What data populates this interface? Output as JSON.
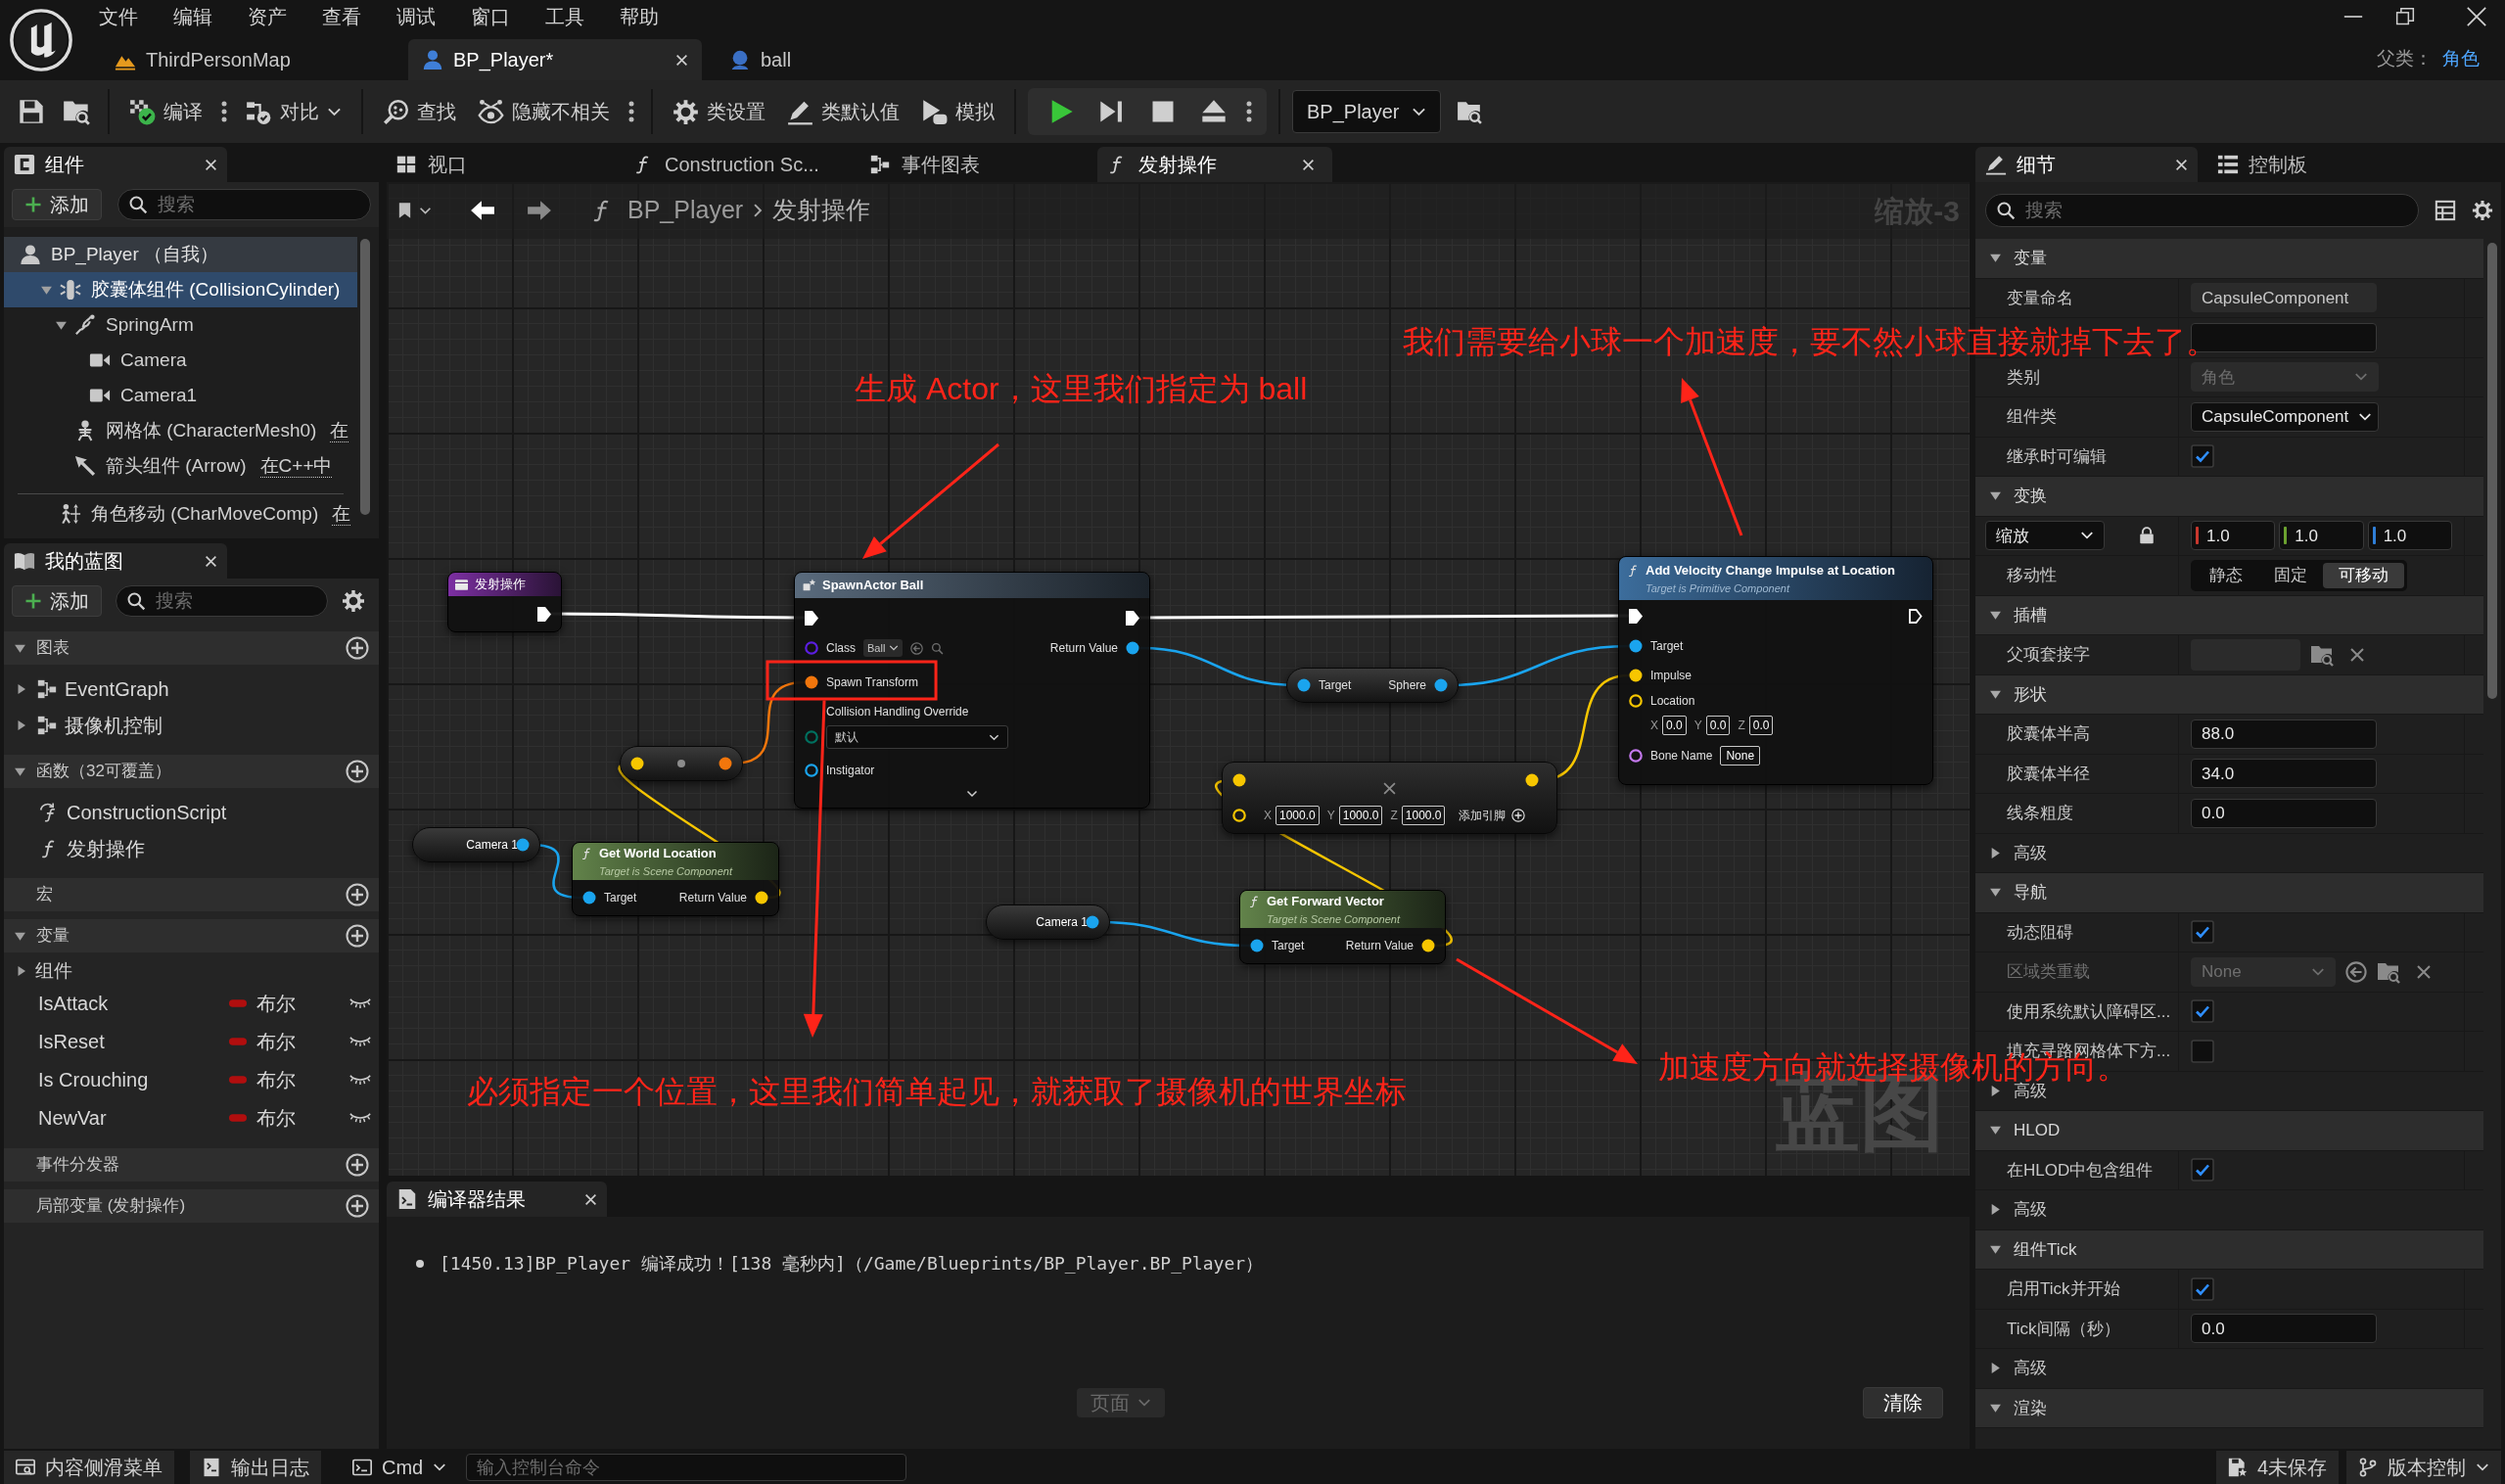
{
  "menu": [
    "文件",
    "编辑",
    "资产",
    "查看",
    "调试",
    "窗口",
    "工具",
    "帮助"
  ],
  "document_tabs": [
    {
      "label": "ThirdPersonMap",
      "kind": "level",
      "selected": false
    },
    {
      "label": "BP_Player*",
      "kind": "blueprint",
      "selected": true
    },
    {
      "label": "ball",
      "kind": "actor",
      "selected": false
    }
  ],
  "parent_class": {
    "label": "父类：",
    "value": "角色"
  },
  "toolbar": {
    "groups": [
      {
        "items": [
          {
            "kind": "save"
          },
          {
            "kind": "browse"
          }
        ]
      },
      {
        "items": [
          {
            "kind": "compile",
            "label": "编译",
            "menu": true
          },
          {
            "kind": "diff",
            "label": "对比",
            "dropdown": true
          }
        ]
      },
      {
        "items": [
          {
            "kind": "find",
            "label": "查找"
          },
          {
            "kind": "hide_unrelated",
            "label": "隐藏不相关",
            "menu": true
          }
        ]
      },
      {
        "items": [
          {
            "kind": "class_settings",
            "label": "类设置"
          },
          {
            "kind": "class_defaults",
            "label": "类默认值"
          },
          {
            "kind": "simulate",
            "label": "模拟"
          }
        ]
      },
      {
        "boxed": true,
        "items": [
          {
            "kind": "play"
          },
          {
            "kind": "advance"
          },
          {
            "kind": "stop"
          },
          {
            "kind": "eject"
          },
          {
            "kind": "more"
          }
        ]
      }
    ],
    "debug_object": "BP_Player"
  },
  "components_panel": {
    "tab": "组件",
    "add_button": "添加",
    "search_placeholder": "搜索",
    "tree": [
      {
        "label": "BP_Player （自我）",
        "kind": "self",
        "selected": false,
        "children": [
          {
            "label": "胶囊体组件 (CollisionCylinder)",
            "kind": "capsule",
            "selected": true,
            "expanded": true,
            "children": [
              {
                "label": "SpringArm",
                "kind": "spring_arm",
                "selected": false,
                "expanded": true,
                "children": [
                  {
                    "label": "Camera",
                    "kind": "camera",
                    "selected": false
                  },
                  {
                    "label": "Camera1",
                    "kind": "camera",
                    "selected": false
                  }
                ]
              },
              {
                "label": "网格体 (CharacterMesh0)",
                "kind": "mesh",
                "selected": false,
                "note": "在"
              },
              {
                "label": "箭头组件 (Arrow)",
                "kind": "arrow",
                "selected": false,
                "note": "在C++中"
              }
            ]
          }
        ]
      }
    ],
    "other_components": [
      {
        "label": "角色移动 (CharMoveComp)",
        "kind": "movement",
        "selected": false,
        "note": "在"
      }
    ]
  },
  "my_blueprint": {
    "tab": "我的蓝图",
    "add_button": "添加",
    "search_placeholder": "搜索",
    "sections": [
      {
        "title": "图表",
        "expanded": true,
        "items": [
          {
            "label": "EventGraph",
            "kind": "graph",
            "expanded": false
          },
          {
            "label": "摄像机控制",
            "kind": "graph",
            "expanded": false
          }
        ]
      },
      {
        "title": "函数（32可覆盖）",
        "expanded": true,
        "items": [
          {
            "label": "ConstructionScript",
            "kind": "construction"
          },
          {
            "label": "发射操作",
            "kind": "function"
          }
        ]
      },
      {
        "title": "宏"
      },
      {
        "title": "变量",
        "expanded": true,
        "categories": [
          {
            "label": "组件",
            "expanded": false
          }
        ],
        "variables": [
          {
            "name": "IsAttack",
            "type": "布尔",
            "exposed": false
          },
          {
            "name": "IsReset",
            "type": "布尔",
            "exposed": false
          },
          {
            "name": "Is Crouching",
            "type": "布尔",
            "exposed": false
          },
          {
            "name": "NewVar",
            "type": "布尔",
            "exposed": false
          }
        ]
      },
      {
        "title": "事件分发器"
      },
      {
        "title": "局部变量 (发射操作)"
      }
    ]
  },
  "graph_tabs": [
    {
      "label": "视口",
      "kind": "viewport",
      "selected": false
    },
    {
      "label": "Construction Sc...",
      "kind": "construction",
      "selected": false
    },
    {
      "label": "事件图表",
      "kind": "event_graph",
      "selected": false
    },
    {
      "label": "发射操作",
      "kind": "function",
      "selected": true
    }
  ],
  "graph": {
    "breadcrumb": [
      "BP_Player",
      "发射操作"
    ],
    "zoom_label": "缩放-3",
    "graph_type_label": "蓝图",
    "nodes": [
      {
        "kind": "entry",
        "title": "发射操作",
        "outputs": [
          {
            "kind": "exec",
            "connected": true
          }
        ]
      },
      {
        "kind": "spawn",
        "title": "SpawnActor Ball",
        "advanced_expanded": false,
        "inputs": [
          {
            "kind": "exec",
            "connected": true
          },
          {
            "label": "Class",
            "kind": "class",
            "connected": false,
            "value": "Ball"
          },
          {
            "label": "Spawn Transform",
            "kind": "transform",
            "connected": true
          },
          {
            "label": "Collision Handling Override",
            "kind": "enum",
            "connected": false,
            "value": "默认"
          },
          {
            "label": "Instigator",
            "kind": "object",
            "connected": false
          }
        ],
        "outputs": [
          {
            "kind": "exec",
            "connected": true
          },
          {
            "label": "Return Value",
            "kind": "object",
            "connected": true
          }
        ]
      },
      {
        "kind": "conversion",
        "inputs": [
          {
            "kind": "vector",
            "connected": true
          }
        ],
        "outputs": [
          {
            "kind": "transform",
            "connected": true
          }
        ]
      },
      {
        "kind": "variable",
        "title": "Camera 1",
        "outputs": [
          {
            "kind": "object",
            "connected": true
          }
        ]
      },
      {
        "kind": "pure",
        "title": "Get World Location",
        "subtitle": "Target is Scene Component",
        "inputs": [
          {
            "label": "Target",
            "kind": "object",
            "connected": true
          }
        ],
        "outputs": [
          {
            "label": "Return Value",
            "kind": "vector",
            "connected": true
          }
        ]
      },
      {
        "kind": "compact",
        "inputs": [
          {
            "label": "Target",
            "kind": "object",
            "connected": true
          }
        ],
        "outputs": [
          {
            "label": "Sphere",
            "kind": "object",
            "connected": true
          }
        ]
      },
      {
        "kind": "call",
        "title": "Add Velocity Change Impulse at Location",
        "subtitle": "Target is Primitive Component",
        "inputs": [
          {
            "kind": "exec",
            "connected": true
          },
          {
            "label": "Target",
            "kind": "object",
            "connected": true
          },
          {
            "label": "Impulse",
            "kind": "vector",
            "connected": true
          },
          {
            "label": "Location",
            "kind": "vector",
            "connected": false,
            "fields": [
              {
                "axis": "X",
                "value": "0.0"
              },
              {
                "axis": "Y",
                "value": "0.0"
              },
              {
                "axis": "Z",
                "value": "0.0"
              }
            ]
          },
          {
            "label": "Bone Name",
            "kind": "name",
            "connected": false,
            "value": "None"
          }
        ],
        "outputs": [
          {
            "kind": "exec",
            "connected": false
          }
        ]
      },
      {
        "kind": "multiply",
        "add_pin": "添加引脚",
        "inputs": [
          {
            "kind": "vector",
            "connected": true
          },
          {
            "kind": "vector",
            "connected": false,
            "fields": [
              {
                "axis": "X",
                "value": "1000.0"
              },
              {
                "axis": "Y",
                "value": "1000.0"
              },
              {
                "axis": "Z",
                "value": "1000.0"
              }
            ]
          }
        ],
        "outputs": [
          {
            "kind": "vector",
            "connected": true
          }
        ]
      },
      {
        "kind": "variable",
        "title": "Camera 1",
        "outputs": [
          {
            "kind": "object",
            "connected": true
          }
        ]
      },
      {
        "kind": "pure",
        "title": "Get Forward Vector",
        "subtitle": "Target is Scene Component",
        "inputs": [
          {
            "label": "Target",
            "kind": "object",
            "connected": true
          }
        ],
        "outputs": [
          {
            "label": "Return Value",
            "kind": "vector",
            "connected": true
          }
        ]
      }
    ],
    "annotations": [
      {
        "text": "生成 Actor，这里我们指定为 ball"
      },
      {
        "text": "我们需要给小球一个加速度，要不然小球直接就掉下去了。"
      },
      {
        "text": "必须指定一个位置，这里我们简单起见，就获取了摄像机的世界坐标"
      },
      {
        "text": "加速度方向就选择摄像机的方向。"
      }
    ]
  },
  "compiler_results": {
    "tab": "编译器结果",
    "messages": [
      "[1450.13]BP_Player 编译成功！[138 毫秒内]（/Game/Blueprints/BP_Player.BP_Player）"
    ],
    "page_button": {
      "label": "页面",
      "disabled": true
    },
    "clear_button": "清除"
  },
  "details": {
    "tabs": [
      {
        "label": "细节",
        "kind": "details",
        "selected": true
      },
      {
        "label": "控制板",
        "kind": "palette",
        "selected": false
      }
    ],
    "search_placeholder": "搜索",
    "rows": [
      {
        "kind": "section",
        "label": "变量",
        "expanded": true
      },
      {
        "kind": "text",
        "label": "变量命名",
        "value": "CapsuleComponent",
        "readonly": true
      },
      {
        "kind": "text",
        "readonly": false
      },
      {
        "kind": "dropdown",
        "label": "类别",
        "value": "角色",
        "disabled": true
      },
      {
        "kind": "dropdown",
        "label": "组件类",
        "value": "CapsuleComponent",
        "disabled": false
      },
      {
        "kind": "checkbox",
        "label": "继承时可编辑",
        "checked": true
      },
      {
        "kind": "section",
        "label": "变换",
        "expanded": true
      },
      {
        "kind": "vector",
        "mode": "缩放",
        "values": [
          {
            "value": "1.0",
            "color": "#c8372d"
          },
          {
            "value": "1.0",
            "color": "#6ba12f"
          },
          {
            "value": "1.0",
            "color": "#2f7fd8"
          }
        ]
      },
      {
        "kind": "segmented",
        "label": "移动性",
        "options": [
          {
            "label": "静态",
            "selected": false
          },
          {
            "label": "固定",
            "selected": false
          },
          {
            "label": "可移动",
            "selected": true
          }
        ]
      },
      {
        "kind": "section",
        "label": "插槽",
        "expanded": true
      },
      {
        "kind": "socket",
        "label": "父项套接字"
      },
      {
        "kind": "section",
        "label": "形状",
        "expanded": true
      },
      {
        "kind": "text",
        "label": "胶囊体半高",
        "value": "88.0",
        "readonly": false
      },
      {
        "kind": "text",
        "label": "胶囊体半径",
        "value": "34.0",
        "readonly": false
      },
      {
        "kind": "text",
        "label": "线条粗度",
        "value": "0.0",
        "readonly": false
      },
      {
        "kind": "advanced",
        "label": "高级",
        "expanded": false
      },
      {
        "kind": "section",
        "label": "导航",
        "expanded": true
      },
      {
        "kind": "checkbox",
        "label": "动态阻碍",
        "checked": true
      },
      {
        "kind": "class_picker",
        "label": "区域类重载",
        "value": "None",
        "disabled": true
      },
      {
        "kind": "checkbox",
        "label": "使用系统默认障碍区...",
        "checked": true
      },
      {
        "kind": "checkbox",
        "label": "填充寻路网格体下方...",
        "checked": false
      },
      {
        "kind": "advanced",
        "label": "高级",
        "expanded": false
      },
      {
        "kind": "section",
        "label": "HLOD",
        "expanded": true
      },
      {
        "kind": "checkbox",
        "label": "在HLOD中包含组件",
        "checked": true
      },
      {
        "kind": "advanced",
        "label": "高级",
        "expanded": false
      },
      {
        "kind": "section",
        "label": "组件Tick",
        "expanded": true
      },
      {
        "kind": "checkbox",
        "label": "启用Tick并开始",
        "checked": true
      },
      {
        "kind": "text",
        "label": "Tick间隔（秒）",
        "value": "0.0",
        "readonly": false
      },
      {
        "kind": "advanced",
        "label": "高级",
        "expanded": false
      },
      {
        "kind": "section",
        "label": "渲染",
        "expanded": true
      }
    ]
  },
  "status_bar": {
    "left": [
      {
        "kind": "content_drawer",
        "label": "内容侧滑菜单"
      },
      {
        "kind": "output_log",
        "label": "输出日志"
      },
      {
        "kind": "cmd",
        "label": "Cmd",
        "dropdown": true
      }
    ],
    "console_placeholder": "输入控制台命令",
    "right": [
      {
        "kind": "unsaved",
        "label": "4未保存"
      },
      {
        "kind": "source_control",
        "label": "版本控制",
        "dropdown": true
      }
    ]
  }
}
